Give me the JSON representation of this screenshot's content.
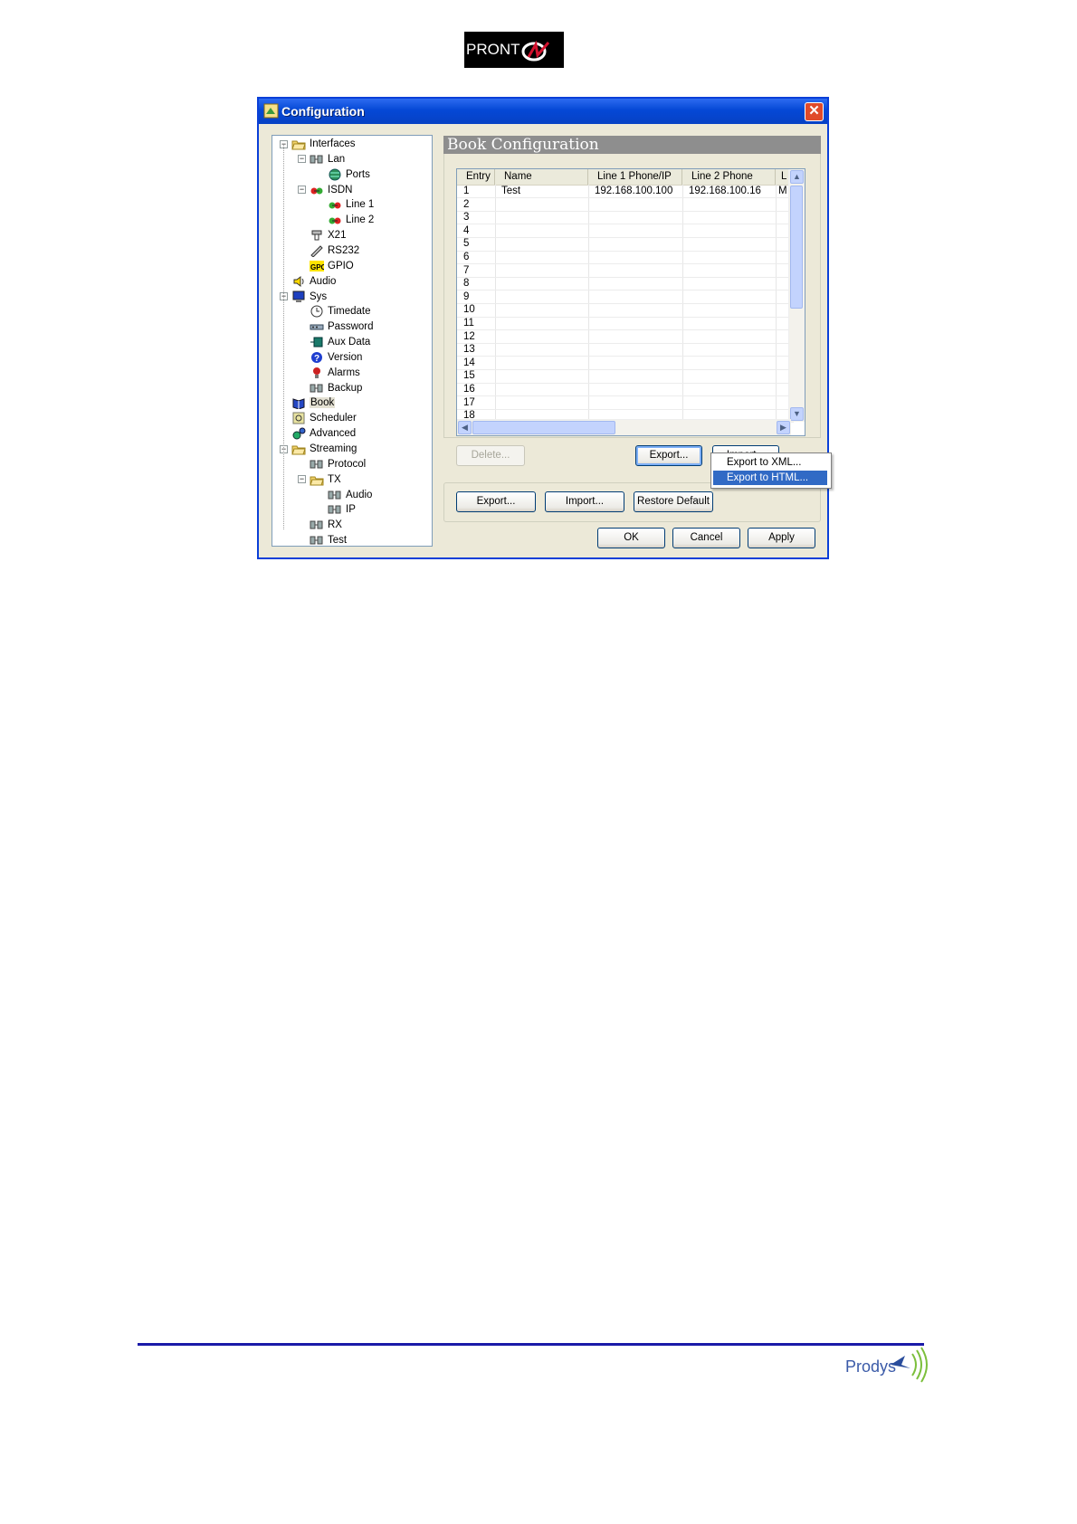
{
  "page": {
    "logo_text": "PRONT",
    "footer_logo_text": "Prodys"
  },
  "window": {
    "title": "Configuration",
    "close_symbol": "✕"
  },
  "tree": [
    {
      "label": "Interfaces",
      "icon": "folder-open-icon",
      "expand": "−"
    },
    {
      "label": "Lan",
      "icon": "network-icon",
      "expand": "−"
    },
    {
      "label": "Ports",
      "icon": "globe-icon"
    },
    {
      "label": "ISDN",
      "icon": "isdn-icon",
      "expand": "−"
    },
    {
      "label": "Line 1",
      "icon": "isdn-line-icon"
    },
    {
      "label": "Line 2",
      "icon": "isdn-line-icon"
    },
    {
      "label": "X21",
      "icon": "x21-icon"
    },
    {
      "label": "RS232",
      "icon": "serial-icon"
    },
    {
      "label": "GPIO",
      "icon": "gpio-icon",
      "icon_text": "GPO"
    },
    {
      "label": "Audio",
      "icon": "speaker-icon"
    },
    {
      "label": "Sys",
      "icon": "monitor-icon",
      "expand": "−"
    },
    {
      "label": "Timedate",
      "icon": "clock-icon"
    },
    {
      "label": "Password",
      "icon": "password-icon"
    },
    {
      "label": "Aux Data",
      "icon": "aux-data-icon"
    },
    {
      "label": "Version",
      "icon": "help-icon"
    },
    {
      "label": "Alarms",
      "icon": "alarm-icon"
    },
    {
      "label": "Backup",
      "icon": "network-icon"
    },
    {
      "label": "Book",
      "icon": "book-icon"
    },
    {
      "label": "Scheduler",
      "icon": "scheduler-icon"
    },
    {
      "label": "Advanced",
      "icon": "advanced-icon"
    },
    {
      "label": "Streaming",
      "icon": "folder-open-icon",
      "expand": "−"
    },
    {
      "label": "Protocol",
      "icon": "network-icon"
    },
    {
      "label": "TX",
      "icon": "folder-open-icon",
      "expand": "−"
    },
    {
      "label": "Audio",
      "icon": "network-icon"
    },
    {
      "label": "IP",
      "icon": "network-icon"
    },
    {
      "label": "RX",
      "icon": "network-icon"
    },
    {
      "label": "Test",
      "icon": "network-icon"
    }
  ],
  "book": {
    "section_title": "Book Configuration",
    "columns": [
      "Entry",
      "Name",
      "Line 1 Phone/IP",
      "Line 2 Phone",
      "L"
    ],
    "rows": [
      [
        "1",
        "Test",
        "192.168.100.100",
        "192.168.100.16",
        "M"
      ],
      [
        "2",
        "",
        "",
        "",
        ""
      ],
      [
        "3",
        "",
        "",
        "",
        ""
      ],
      [
        "4",
        "",
        "",
        "",
        ""
      ],
      [
        "5",
        "",
        "",
        "",
        ""
      ],
      [
        "6",
        "",
        "",
        "",
        ""
      ],
      [
        "7",
        "",
        "",
        "",
        ""
      ],
      [
        "8",
        "",
        "",
        "",
        ""
      ],
      [
        "9",
        "",
        "",
        "",
        ""
      ],
      [
        "10",
        "",
        "",
        "",
        ""
      ],
      [
        "11",
        "",
        "",
        "",
        ""
      ],
      [
        "12",
        "",
        "",
        "",
        ""
      ],
      [
        "13",
        "",
        "",
        "",
        ""
      ],
      [
        "14",
        "",
        "",
        "",
        ""
      ],
      [
        "15",
        "",
        "",
        "",
        ""
      ],
      [
        "16",
        "",
        "",
        "",
        ""
      ],
      [
        "17",
        "",
        "",
        "",
        ""
      ],
      [
        "18",
        "",
        "",
        "",
        ""
      ]
    ],
    "delete_label": "Delete...",
    "export_label": "Export...",
    "import_label": "Import..."
  },
  "context_menu": {
    "items": [
      "Export to XML...",
      "Export to HTML..."
    ],
    "highlighted_index": 1
  },
  "bottom": {
    "export_label": "Export...",
    "import_label": "Import...",
    "restore_label": "Restore Default"
  },
  "dialog_buttons": {
    "ok": "OK",
    "cancel": "Cancel",
    "apply": "Apply"
  },
  "colors": {
    "titlebar": "#0548d6",
    "selection": "#316ac5",
    "header_gray": "#8e8e8e",
    "footer_line": "#1a1aa8"
  }
}
